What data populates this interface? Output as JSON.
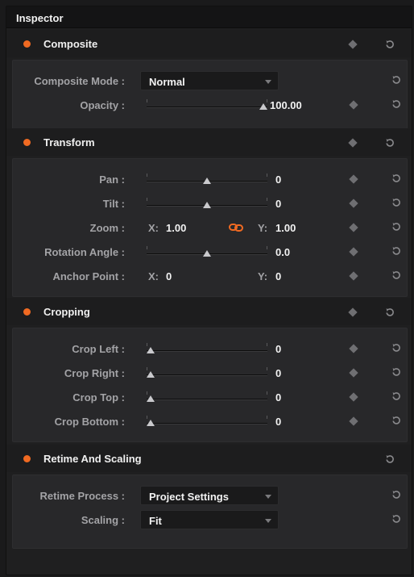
{
  "panel": {
    "title": "Inspector"
  },
  "composite": {
    "title": "Composite",
    "mode_label": "Composite Mode :",
    "mode_value": "Normal",
    "opacity_label": "Opacity :",
    "opacity_value": "100.00",
    "opacity_level": 1.0
  },
  "transform": {
    "title": "Transform",
    "pan": {
      "label": "Pan :",
      "value": "0",
      "level": 0.5
    },
    "tilt": {
      "label": "Tilt :",
      "value": "0",
      "level": 0.5
    },
    "zoom": {
      "label": "Zoom :",
      "x_label": "X:",
      "x_value": "1.00",
      "y_label": "Y:",
      "y_value": "1.00"
    },
    "rotation": {
      "label": "Rotation Angle :",
      "value": "0.0",
      "level": 0.5
    },
    "anchor": {
      "label": "Anchor Point :",
      "x_label": "X:",
      "x_value": "0",
      "y_label": "Y:",
      "y_value": "0"
    }
  },
  "cropping": {
    "title": "Cropping",
    "left": {
      "label": "Crop Left :",
      "value": "0",
      "level": 0
    },
    "right": {
      "label": "Crop Right :",
      "value": "0",
      "level": 0
    },
    "top": {
      "label": "Crop Top :",
      "value": "0",
      "level": 0
    },
    "bottom": {
      "label": "Crop Bottom :",
      "value": "0",
      "level": 0
    }
  },
  "retime": {
    "title": "Retime And Scaling",
    "process_label": "Retime Process :",
    "process_value": "Project Settings",
    "scaling_label": "Scaling :",
    "scaling_value": "Fit"
  },
  "colors": {
    "accent": "#f06a22",
    "background": "#1f1f20",
    "section_body": "#28282a"
  },
  "icons": {
    "keyframe": "diamond",
    "reset": "circular-arrow",
    "link": "chain-link"
  }
}
